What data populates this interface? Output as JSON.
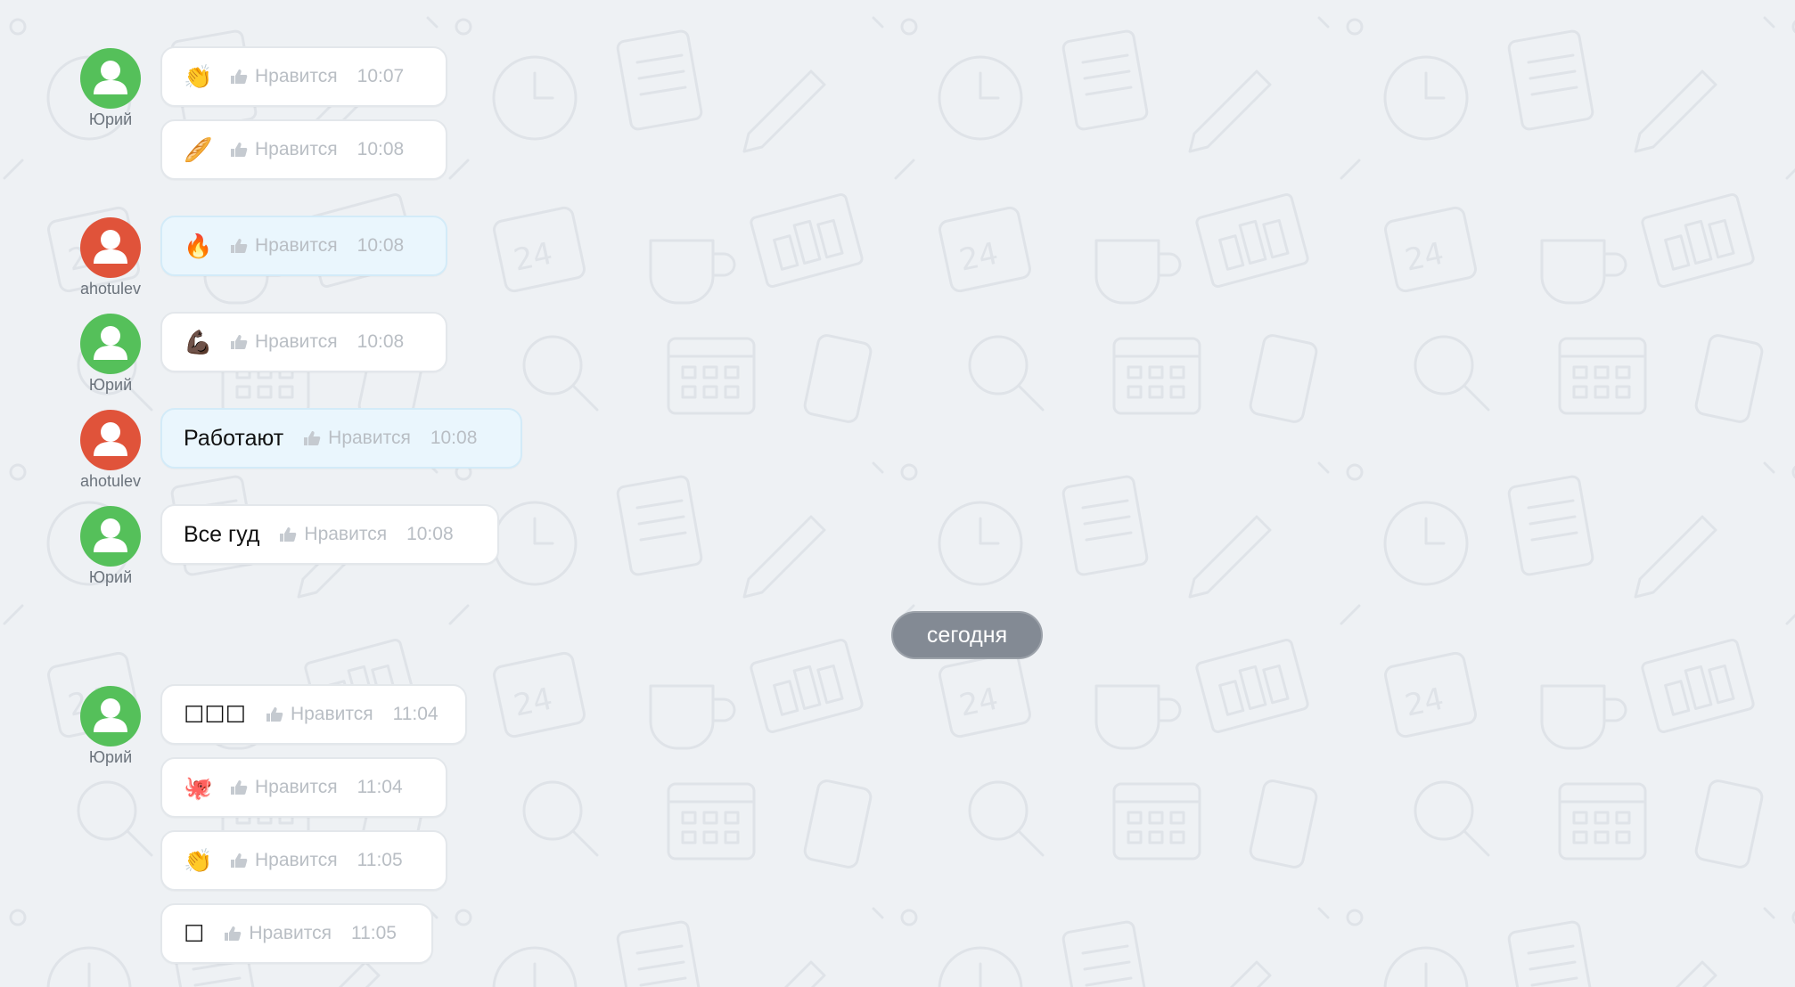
{
  "colors": {
    "background": "#eef1f4",
    "avatar_green": "#55c05a",
    "avatar_red": "#e0533a",
    "bubble_own": "#eaf6fd",
    "date_pill": "#838a94"
  },
  "date_separator": "сегодня",
  "like_label": "Нравится",
  "authors": {
    "yuri": "Юрий",
    "ahotulev": "ahotulev"
  },
  "messages": [
    {
      "author": "Юрий",
      "content": "👏",
      "time": "10:07"
    },
    {
      "author": "Юрий",
      "content": "🥖",
      "time": "10:08"
    },
    {
      "author": "ahotulev",
      "content": "🔥",
      "time": "10:08"
    },
    {
      "author": "Юрий",
      "content": "💪🏿",
      "time": "10:08"
    },
    {
      "author": "ahotulev",
      "content": "Работают",
      "time": "10:08"
    },
    {
      "author": "Юрий",
      "content": "Все гуд",
      "time": "10:08"
    },
    {
      "author": "Юрий",
      "content": "☐☐☐",
      "time": "11:04"
    },
    {
      "author": "Юрий",
      "content": "🐙",
      "time": "11:04"
    },
    {
      "author": "Юрий",
      "content": "👏",
      "time": "11:05"
    },
    {
      "author": "Юрий",
      "content": "☐",
      "time": "11:05"
    }
  ]
}
